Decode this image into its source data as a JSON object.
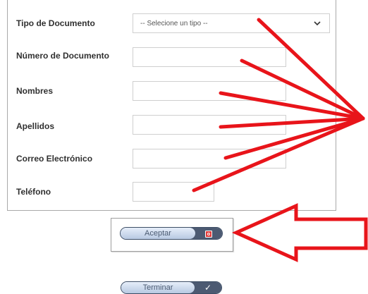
{
  "form": {
    "tipo_label": "Tipo de Documento",
    "tipo_value": "-- Selecione un tipo --",
    "numero_label": "Número de Documento",
    "nombres_label": "Nombres",
    "apellidos_label": "Apellidos",
    "correo_label": "Correo Electrónico",
    "telefono_label": "Teléfono"
  },
  "buttons": {
    "aceptar": "Aceptar",
    "terminar": "Terminar",
    "terminar_icon": "✓"
  },
  "icons": {
    "select": "chevron-down-icon",
    "aceptar": "close-icon",
    "terminar": "checkmark-icon"
  },
  "colors": {
    "annotation": "#e8141a",
    "button_dark": "#4c5a72",
    "button_light": "#c9d7ec"
  }
}
